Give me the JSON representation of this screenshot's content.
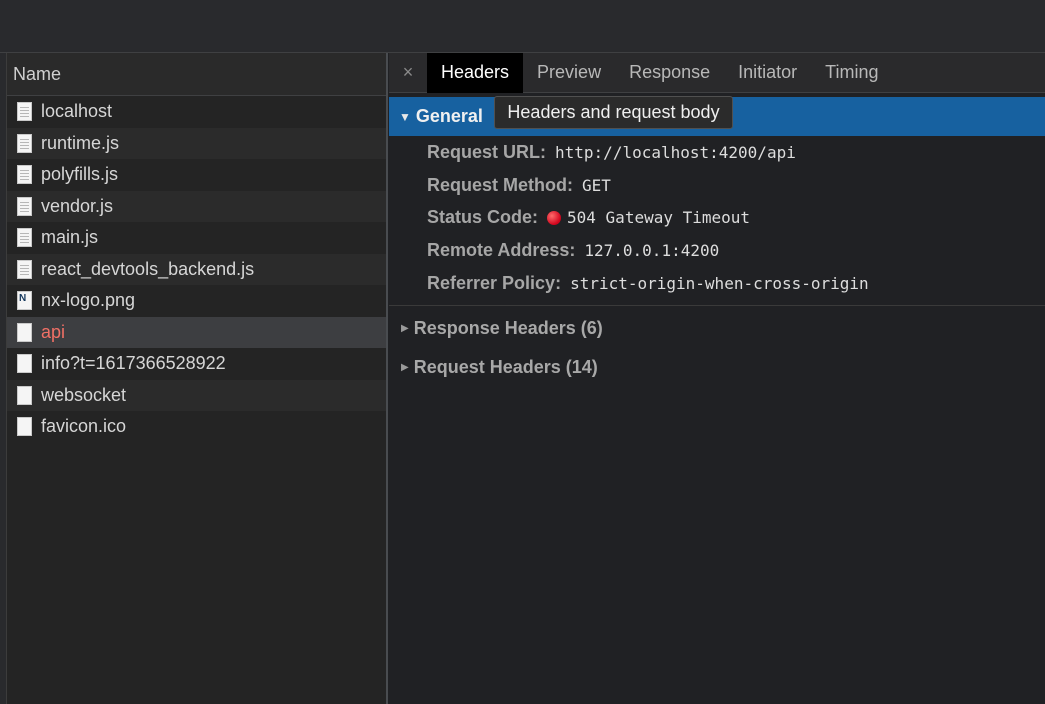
{
  "request_list": {
    "header": "Name",
    "items": [
      {
        "name": "localhost",
        "icon": "doc-icon"
      },
      {
        "name": "runtime.js",
        "icon": "doc-icon"
      },
      {
        "name": "polyfills.js",
        "icon": "doc-icon"
      },
      {
        "name": "vendor.js",
        "icon": "doc-icon"
      },
      {
        "name": "main.js",
        "icon": "doc-icon"
      },
      {
        "name": "react_devtools_backend.js",
        "icon": "doc-icon"
      },
      {
        "name": "nx-logo.png",
        "icon": "image-icon"
      },
      {
        "name": "api",
        "icon": "blank-icon",
        "selected": true,
        "error": true
      },
      {
        "name": "info?t=1617366528922",
        "icon": "blank-icon"
      },
      {
        "name": "websocket",
        "icon": "blank-icon"
      },
      {
        "name": "favicon.ico",
        "icon": "blank-icon"
      }
    ]
  },
  "tabs": {
    "close": "×",
    "items": [
      "Headers",
      "Preview",
      "Response",
      "Initiator",
      "Timing"
    ],
    "active": "Headers"
  },
  "tooltip": "Headers and request body",
  "general": {
    "title": "General",
    "fields": [
      {
        "key": "Request URL:",
        "value": "http://localhost:4200/api"
      },
      {
        "key": "Request Method:",
        "value": "GET"
      },
      {
        "key": "Status Code:",
        "value": "504 Gateway Timeout",
        "status_dot": true
      },
      {
        "key": "Remote Address:",
        "value": "127.0.0.1:4200"
      },
      {
        "key": "Referrer Policy:",
        "value": "strict-origin-when-cross-origin"
      }
    ]
  },
  "sections": [
    {
      "title": "Response Headers (6)"
    },
    {
      "title": "Request Headers (14)"
    }
  ],
  "colors": {
    "accent": "#1761a0",
    "error_text": "#f07066",
    "status_error": "#d0021b"
  }
}
